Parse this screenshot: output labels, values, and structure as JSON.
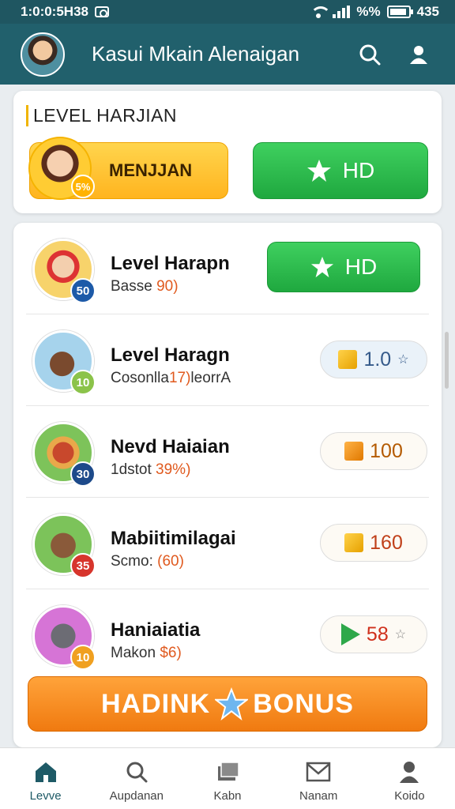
{
  "status_bar": {
    "time": "1:0:0:5H38",
    "battery_text": "%%",
    "right_text": "435"
  },
  "app_bar": {
    "title": "Kasui Mkain Alenaigan"
  },
  "daily_card": {
    "title": "LEVEL HARJIAN",
    "left_button_label": "MENJJAN",
    "left_badge": "5%",
    "right_button_label": "HD"
  },
  "levels": [
    {
      "title": "Level Harapn",
      "subtitle_prefix": "Basse ",
      "subtitle_value": "90)",
      "badge": "50",
      "badge_color": "#1d5aa8",
      "action": "HD",
      "action_type": "button"
    },
    {
      "title": "Level Haragn",
      "subtitle_prefix": "Cosonlla",
      "subtitle_value": "17)",
      "subtitle_suffix": "leorrA",
      "badge": "10",
      "badge_color": "#8bc34a",
      "action": "1.0",
      "action_type": "pill-blue"
    },
    {
      "title": "Nevd Haiaian",
      "subtitle_prefix": "1dstot ",
      "subtitle_value": "39%)",
      "badge": "30",
      "badge_color": "#1d4a8a",
      "action": "100",
      "action_type": "pill"
    },
    {
      "title": "Mabiitimilagai",
      "subtitle_prefix": "Scmo: ",
      "subtitle_value": "(60)",
      "badge": "35",
      "badge_color": "#d7352c",
      "action": "160",
      "action_type": "pill"
    },
    {
      "title": "Haniaiatia",
      "subtitle_prefix": "Makon ",
      "subtitle_value": "$6)",
      "badge": "10",
      "badge_color": "#f0a020",
      "action": "58",
      "action_type": "pill-play"
    }
  ],
  "bonus_button": {
    "left": "HADINK",
    "right": "BONUS"
  },
  "bottom_nav": [
    {
      "label": "Levve",
      "icon": "home-icon"
    },
    {
      "label": "Aupdanan",
      "icon": "search-icon"
    },
    {
      "label": "Kabn",
      "icon": "cards-icon"
    },
    {
      "label": "Nanam",
      "icon": "mail-icon"
    },
    {
      "label": "Koido",
      "icon": "profile-icon"
    }
  ],
  "colors": {
    "primary": "#21606c",
    "green": "#2ab44a",
    "orange": "#f58a1f",
    "yellow": "#ffc531"
  }
}
